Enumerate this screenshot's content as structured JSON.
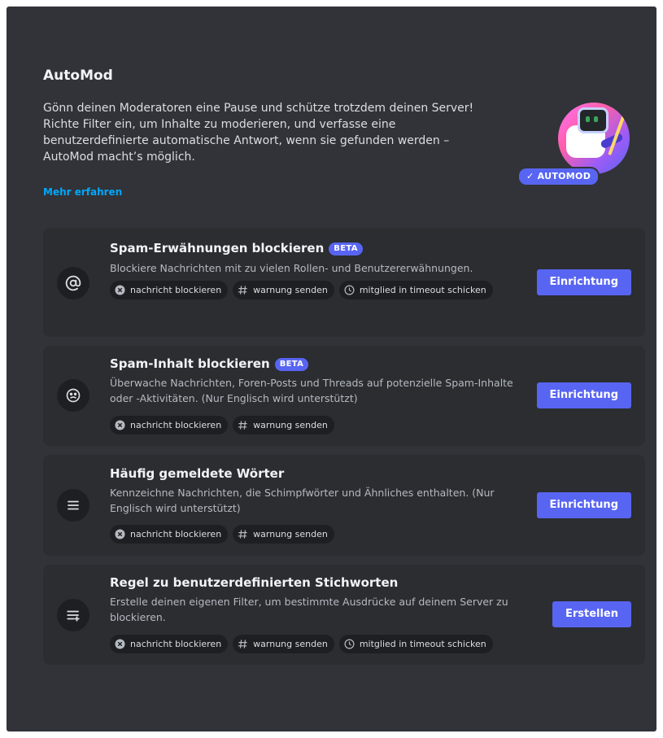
{
  "header": {
    "title": "AutoMod",
    "description": "Gönn deinen Moderatoren eine Pause und schütze trotzdem deinen Server! Richte Filter ein, um Inhalte zu moderieren, und verfasse eine benutzerdefinierte automatische Antwort, wenn sie gefunden werden – AutoMod macht’s möglich.",
    "learn_more": "Mehr erfahren",
    "badge": "✓ AUTOMOD"
  },
  "rules": [
    {
      "title": "Spam-Erwähnungen blockieren",
      "badge": "BETA",
      "description": "Blockiere Nachrichten mit zu vielen Rollen- und Benutzererwähnungen.",
      "action": "Einrichtung",
      "chips": [
        "nachricht blockieren",
        "warnung senden",
        "mitglied in timeout schicken"
      ]
    },
    {
      "title": "Spam-Inhalt blockieren",
      "badge": "BETA",
      "description": "Überwache Nachrichten, Foren-Posts und Threads auf potenzielle Spam-Inhalte oder -Aktivitäten. (Nur Englisch wird unterstützt)",
      "action": "Einrichtung",
      "chips": [
        "nachricht blockieren",
        "warnung senden"
      ]
    },
    {
      "title": "Häufig gemeldete Wörter",
      "description": "Kennzeichne Nachrichten, die Schimpfwörter und Ähnliches enthalten. (Nur Englisch wird unterstützt)",
      "action": "Einrichtung",
      "chips": [
        "nachricht blockieren",
        "warnung senden"
      ]
    },
    {
      "title": "Regel zu benutzerdefinierten Stichworten",
      "description": "Erstelle deinen eigenen Filter, um bestimmte Ausdrücke auf deinem Server zu blockieren.",
      "action": "Erstellen",
      "chips": [
        "nachricht blockieren",
        "warnung senden",
        "mitglied in timeout schicken"
      ]
    }
  ],
  "colors": {
    "background": "#313338",
    "card": "#2b2d31",
    "chip": "#1e1f22",
    "brand": "#5865f2",
    "link": "#00a8fc"
  }
}
